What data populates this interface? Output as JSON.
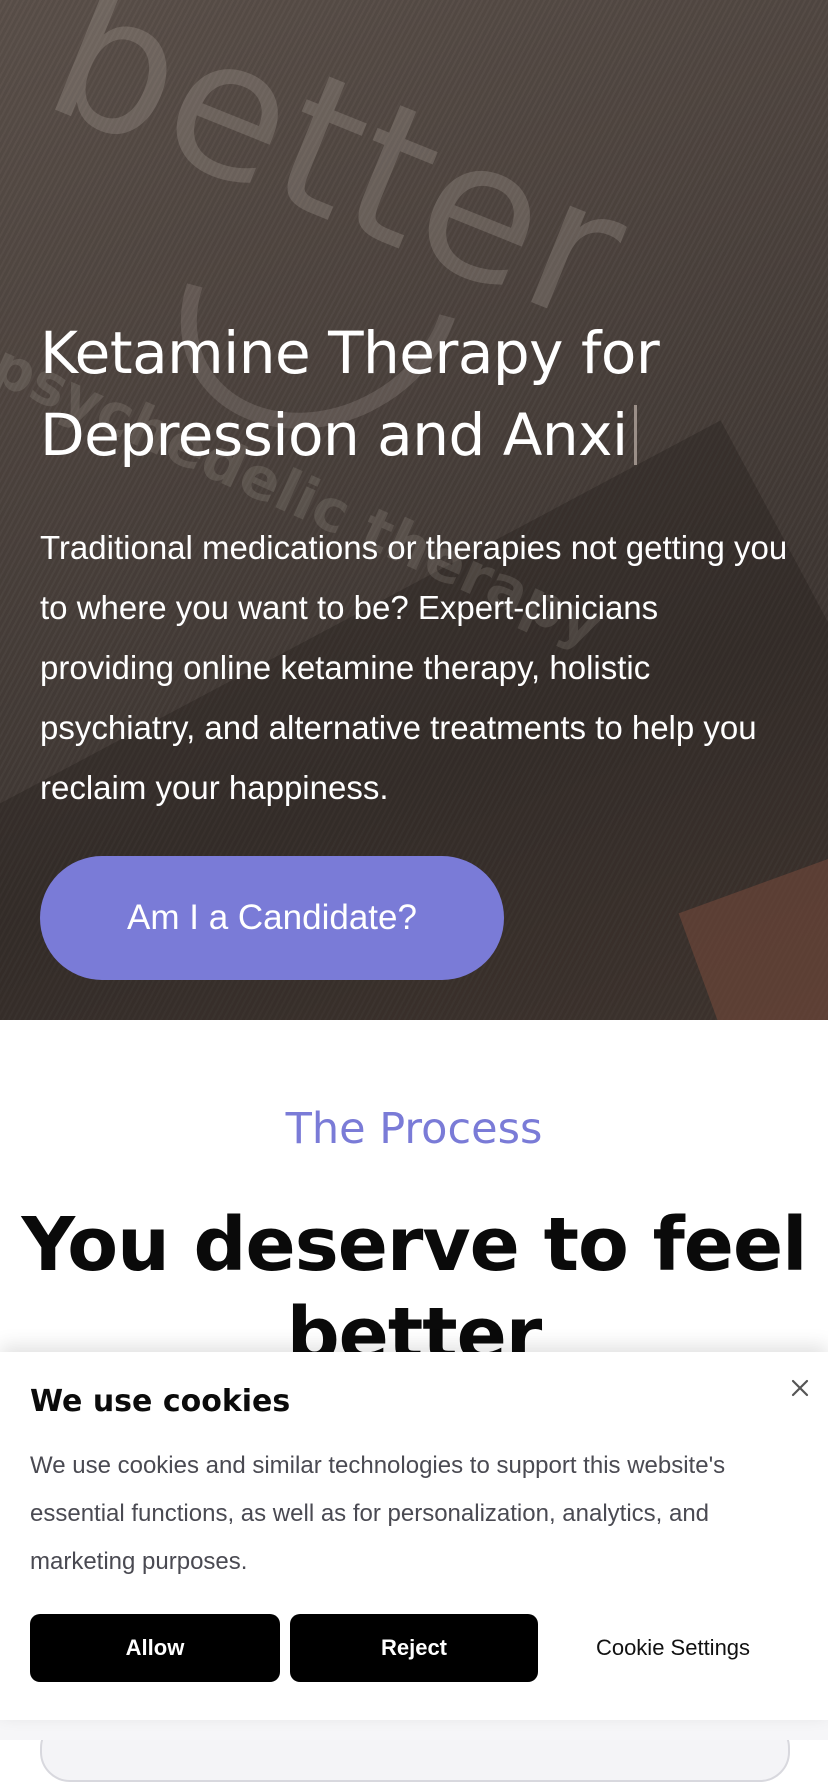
{
  "hero": {
    "background_text": "better",
    "background_subtext": "psychedelic therapy",
    "title": "Ketamine Therapy for Depression and Anxi",
    "description": "Traditional medications or therapies not getting you to where you want to be? Expert-clinicians providing online ketamine therapy, holistic psychiatry, and alternative treatments to help you reclaim your happiness.",
    "cta_label": "Am I a Candidate?"
  },
  "process": {
    "eyebrow": "The Process",
    "headline": "You deserve to feel better"
  },
  "cookie_banner": {
    "title": "We use cookies",
    "text": "We use cookies and similar technologies to support this website's essential functions, as well as for personalization, analytics, and marketing purposes.",
    "allow_label": "Allow",
    "reject_label": "Reject",
    "settings_label": "Cookie Settings",
    "close_icon": "close-icon"
  },
  "colors": {
    "accent": "#7a7bd7",
    "hero_bg": "#4a413c",
    "button_dark": "#000000"
  }
}
